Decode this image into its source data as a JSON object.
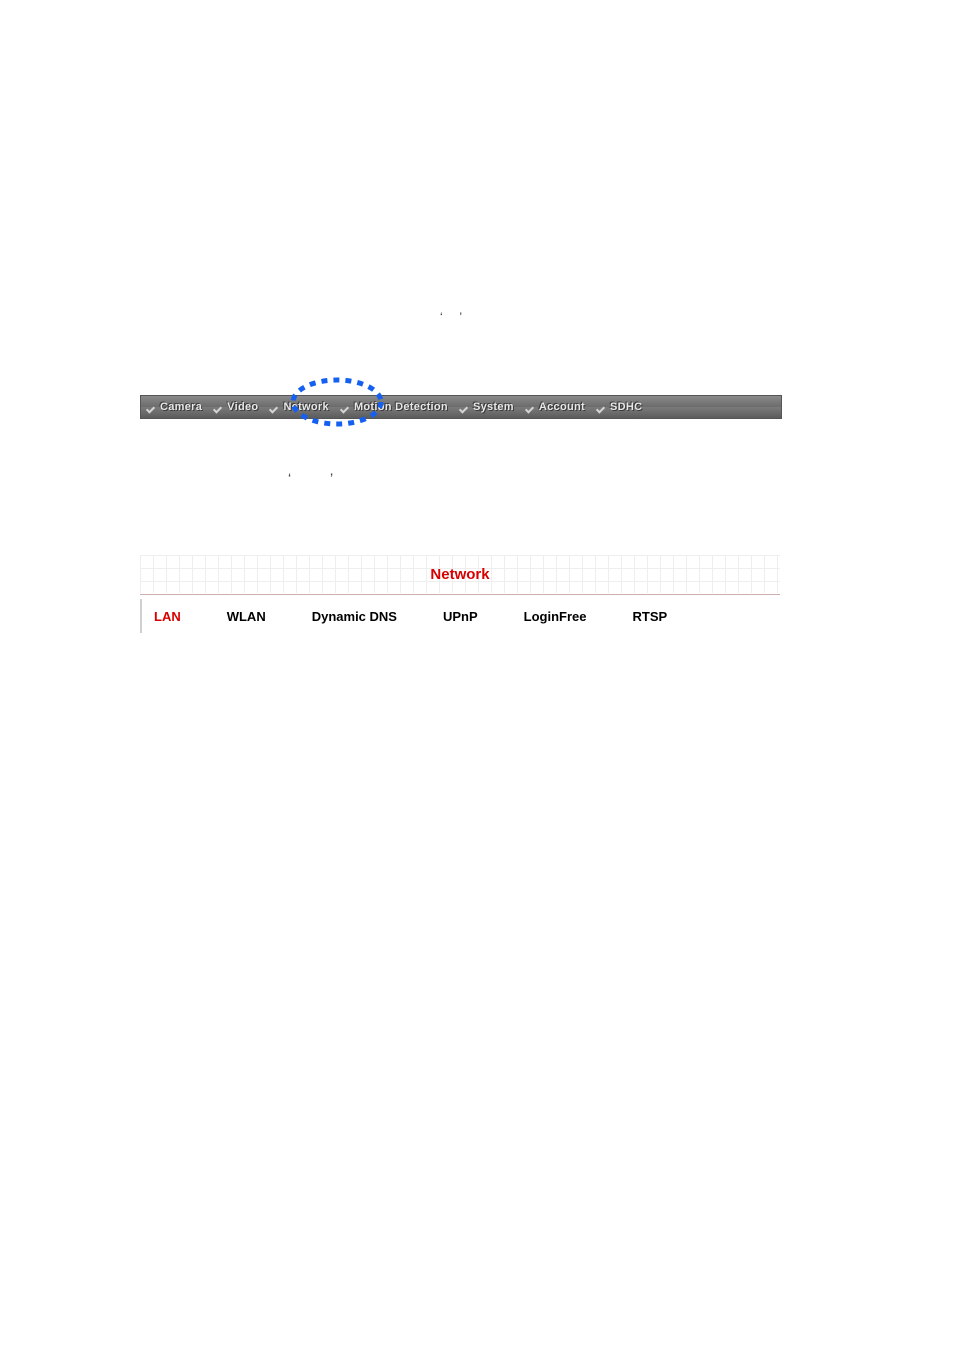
{
  "instructions": {
    "line1_before": "‘",
    "line1_after": "’",
    "line2_before": "‘",
    "line2_after": "’"
  },
  "top_menu": {
    "items": [
      {
        "label": "Camera"
      },
      {
        "label": "Video"
      },
      {
        "label": "Network"
      },
      {
        "label": "Motion Detection"
      },
      {
        "label": "System"
      },
      {
        "label": "Account"
      },
      {
        "label": "SDHC"
      }
    ]
  },
  "panel": {
    "title": "Network",
    "tabs": [
      {
        "label": "LAN",
        "active": true
      },
      {
        "label": "WLAN",
        "active": false
      },
      {
        "label": "Dynamic DNS",
        "active": false
      },
      {
        "label": "UPnP",
        "active": false
      },
      {
        "label": "LoginFree",
        "active": false
      },
      {
        "label": "RTSP",
        "active": false
      }
    ]
  }
}
